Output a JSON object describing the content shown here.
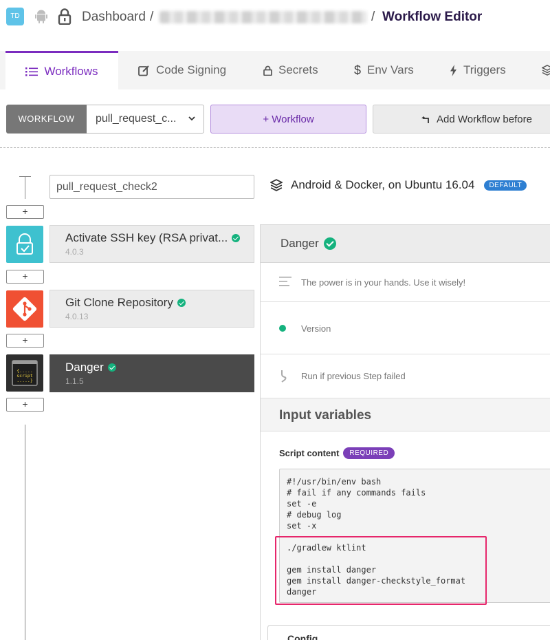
{
  "topbar": {
    "avatar": "TD",
    "dashboard": "Dashboard",
    "sep": "/",
    "page_title": "Workflow Editor"
  },
  "tabs": [
    {
      "label": "Workflows",
      "icon": "list-icon",
      "active": true
    },
    {
      "label": "Code Signing",
      "icon": "edit-icon"
    },
    {
      "label": "Secrets",
      "icon": "lock-icon"
    },
    {
      "label": "Env Vars",
      "icon": "dollar-icon"
    },
    {
      "label": "Triggers",
      "icon": "bolt-icon"
    },
    {
      "label": "",
      "icon": "stack-icon"
    }
  ],
  "toolbar": {
    "workflow_label": "WORKFLOW",
    "workflow_selected": "pull_request_c...",
    "add_workflow": "+ Workflow",
    "add_before": "Add Workflow before"
  },
  "workflow_name": "pull_request_check2",
  "steps": [
    {
      "title": "Activate SSH key (RSA privat...",
      "version": "4.0.3",
      "icon": "ssh-lock-icon"
    },
    {
      "title": "Git Clone Repository",
      "version": "4.0.13",
      "icon": "git-icon"
    },
    {
      "title": "Danger",
      "version": "1.1.5",
      "icon": "script-icon",
      "selected": true
    }
  ],
  "plus_label": "+",
  "stack": {
    "name": "Android & Docker, on Ubuntu 16.04",
    "badge": "DEFAULT"
  },
  "detail": {
    "title": "Danger",
    "description": "The power is in your hands. Use it wisely!",
    "version_label": "Version",
    "run_if_label": "Run if previous Step failed",
    "input_variables": "Input variables",
    "script_label": "Script content",
    "required_badge": "REQUIRED",
    "script_content": "#!/usr/bin/env bash\n# fail if any commands fails\nset -e\n# debug log\nset -x\n\n./gradlew ktlint\n\ngem install danger\ngem install danger-checkstyle_format\ndanger",
    "config_label": "Config"
  },
  "colors": {
    "accent": "#7b2cbf",
    "success": "#15b27e",
    "highlight": "#e6266b",
    "default_badge": "#2e7fd2"
  }
}
